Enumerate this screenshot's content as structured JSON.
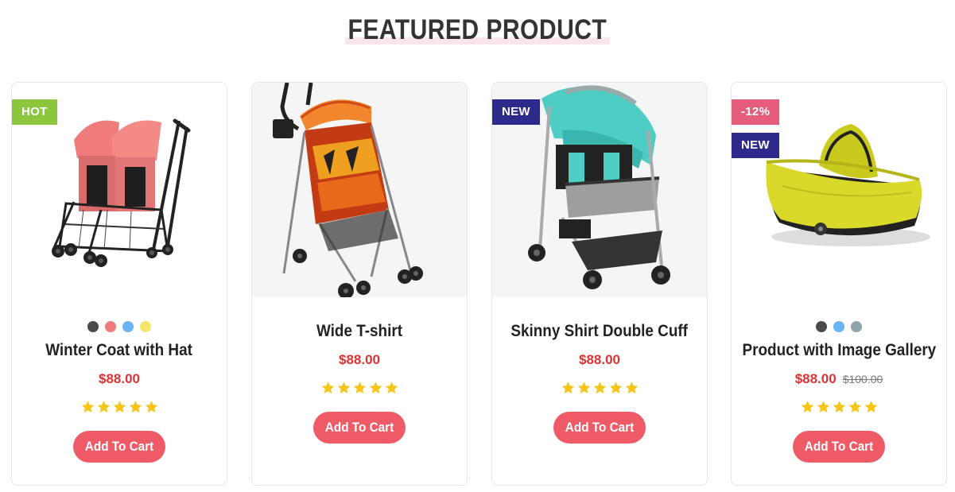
{
  "section": {
    "title": "FEATURED PRODUCT"
  },
  "colors": {
    "accent": "#ee5a66",
    "price": "#d93333",
    "star": "#f5c518",
    "hot_badge": "#8cc63f",
    "new_badge": "#2e2a8c",
    "sale_badge": "#e55d7b",
    "title_highlight": "#fce4ec"
  },
  "products": [
    {
      "title": "Winter Coat with Hat",
      "price": "$88.00",
      "old_price": "",
      "rating": 5,
      "swatches": [
        "#4a4a4a",
        "#f07b7b",
        "#6ab4f5",
        "#f7e66a"
      ],
      "badges": [
        {
          "label": "HOT",
          "color": "#8cc63f"
        }
      ],
      "image": "pink-double-stroller",
      "cta": "Add To Cart"
    },
    {
      "title": "Wide T-shirt",
      "price": "$88.00",
      "old_price": "",
      "rating": 5,
      "swatches": [],
      "badges": [],
      "image": "flame-umbrella-stroller",
      "cta": "Add To Cart"
    },
    {
      "title": "Skinny Shirt Double Cuff",
      "price": "$88.00",
      "old_price": "",
      "rating": 5,
      "swatches": [],
      "badges": [
        {
          "label": "NEW",
          "color": "#2e2a8c"
        }
      ],
      "image": "teal-stroller",
      "cta": "Add To Cart"
    },
    {
      "title": "Product with Image Gallery",
      "price": "$88.00",
      "old_price": "$100.00",
      "rating": 5,
      "swatches": [
        "#4a4a4a",
        "#6ab4f5",
        "#8fa3ad"
      ],
      "badges": [
        {
          "label": "-12%",
          "color": "#e55d7b"
        },
        {
          "label": "NEW",
          "color": "#2e2a8c"
        }
      ],
      "image": "yellow-bassinet",
      "cta": "Add To Cart"
    }
  ]
}
